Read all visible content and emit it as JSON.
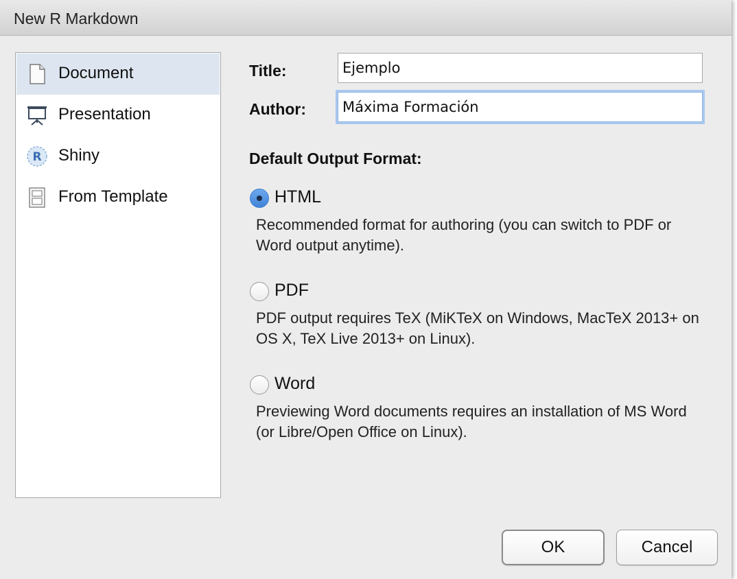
{
  "window": {
    "title": "New R Markdown"
  },
  "sidebar": {
    "items": [
      {
        "label": "Document",
        "icon": "document-icon",
        "selected": true
      },
      {
        "label": "Presentation",
        "icon": "presentation-icon",
        "selected": false
      },
      {
        "label": "Shiny",
        "icon": "shiny-r-icon",
        "selected": false
      },
      {
        "label": "From Template",
        "icon": "template-icon",
        "selected": false
      }
    ]
  },
  "form": {
    "title_label": "Title:",
    "title_value": "Ejemplo",
    "author_label": "Author:",
    "author_value": "Máxima Formación"
  },
  "output": {
    "heading": "Default Output Format:",
    "options": [
      {
        "label": "HTML",
        "checked": true,
        "description": "Recommended format for authoring (you can switch to PDF or Word output anytime)."
      },
      {
        "label": "PDF",
        "checked": false,
        "description": "PDF output requires TeX (MiKTeX on Windows, MacTeX 2013+ on OS X, TeX Live 2013+ on Linux)."
      },
      {
        "label": "Word",
        "checked": false,
        "description": "Previewing Word documents requires an installation of MS Word (or Libre/Open Office on Linux)."
      }
    ]
  },
  "buttons": {
    "ok": "OK",
    "cancel": "Cancel"
  },
  "colors": {
    "selection": "#dde6f0",
    "radio_checked": "#4a8ad9",
    "focus_ring": "#a9c8ef"
  }
}
